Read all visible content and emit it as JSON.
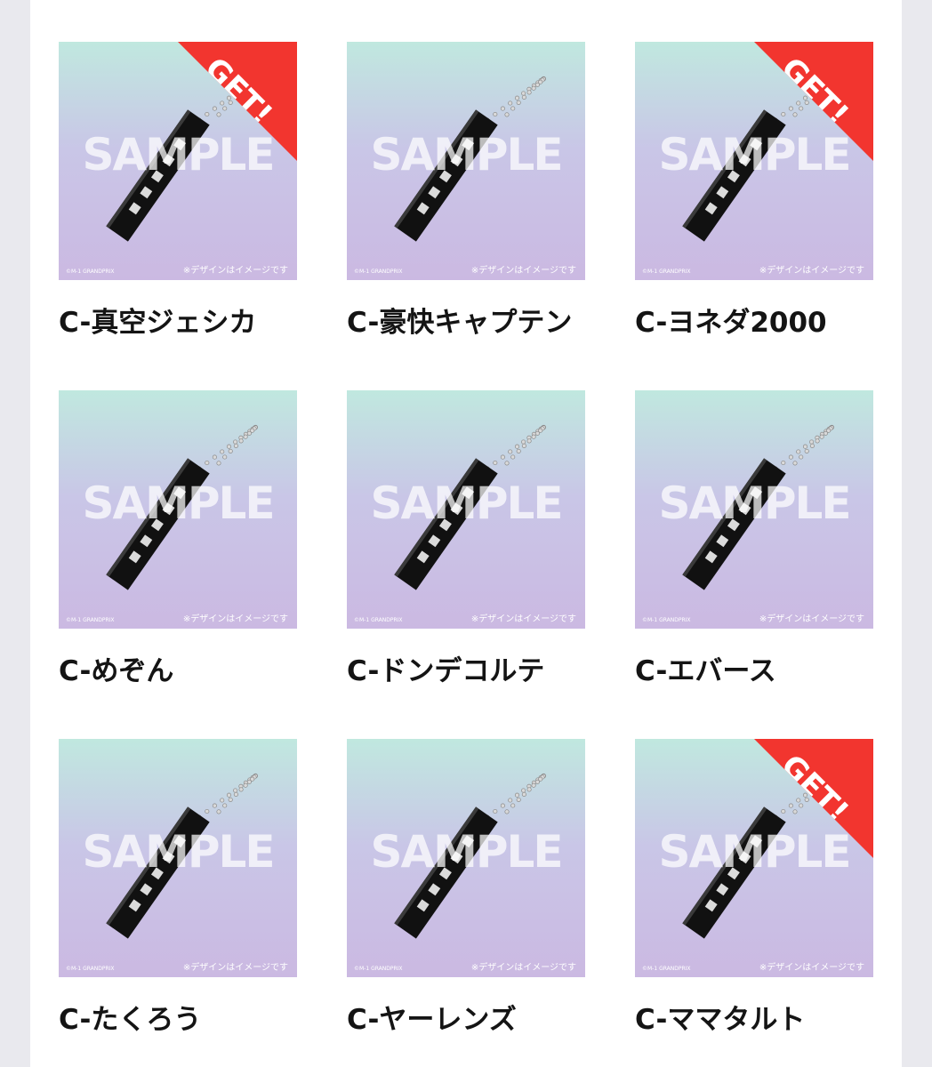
{
  "items": [
    {
      "name": "C-真空ジェシカ",
      "badge": "GET!",
      "got": true,
      "sample": "SAMPLE",
      "note": "※デザインはイメージです",
      "copyright": "©M-1 GRANDPRIX"
    },
    {
      "name": "C-豪快キャプテン",
      "badge": "",
      "got": false,
      "sample": "SAMPLE",
      "note": "※デザインはイメージです",
      "copyright": "©M-1 GRANDPRIX"
    },
    {
      "name": "C-ヨネダ2000",
      "badge": "GET!",
      "got": true,
      "sample": "SAMPLE",
      "note": "※デザインはイメージです",
      "copyright": "©M-1 GRANDPRIX"
    },
    {
      "name": "C-めぞん",
      "badge": "",
      "got": false,
      "sample": "SAMPLE",
      "note": "※デザインはイメージです",
      "copyright": "©M-1 GRANDPRIX"
    },
    {
      "name": "C-ドンデコルテ",
      "badge": "",
      "got": false,
      "sample": "SAMPLE",
      "note": "※デザインはイメージです",
      "copyright": "©M-1 GRANDPRIX"
    },
    {
      "name": "C-エバース",
      "badge": "",
      "got": false,
      "sample": "SAMPLE",
      "note": "※デザインはイメージです",
      "copyright": "©M-1 GRANDPRIX"
    },
    {
      "name": "C-たくろう",
      "badge": "",
      "got": false,
      "sample": "SAMPLE",
      "note": "※デザインはイメージです",
      "copyright": "©M-1 GRANDPRIX"
    },
    {
      "name": "C-ヤーレンズ",
      "badge": "",
      "got": false,
      "sample": "SAMPLE",
      "note": "※デザインはイメージです",
      "copyright": "©M-1 GRANDPRIX"
    },
    {
      "name": "C-ママタルト",
      "badge": "GET!",
      "got": true,
      "sample": "SAMPLE",
      "note": "※デザインはイメージです",
      "copyright": "©M-1 GRANDPRIX"
    }
  ],
  "colors": {
    "badge": "#f2352f",
    "background_top": "#c0e8df",
    "background_bottom": "#cbb9e2",
    "keychain": "#111111"
  },
  "icons": {
    "product": "keychain-stick-icon",
    "chain": "ball-chain-icon"
  }
}
